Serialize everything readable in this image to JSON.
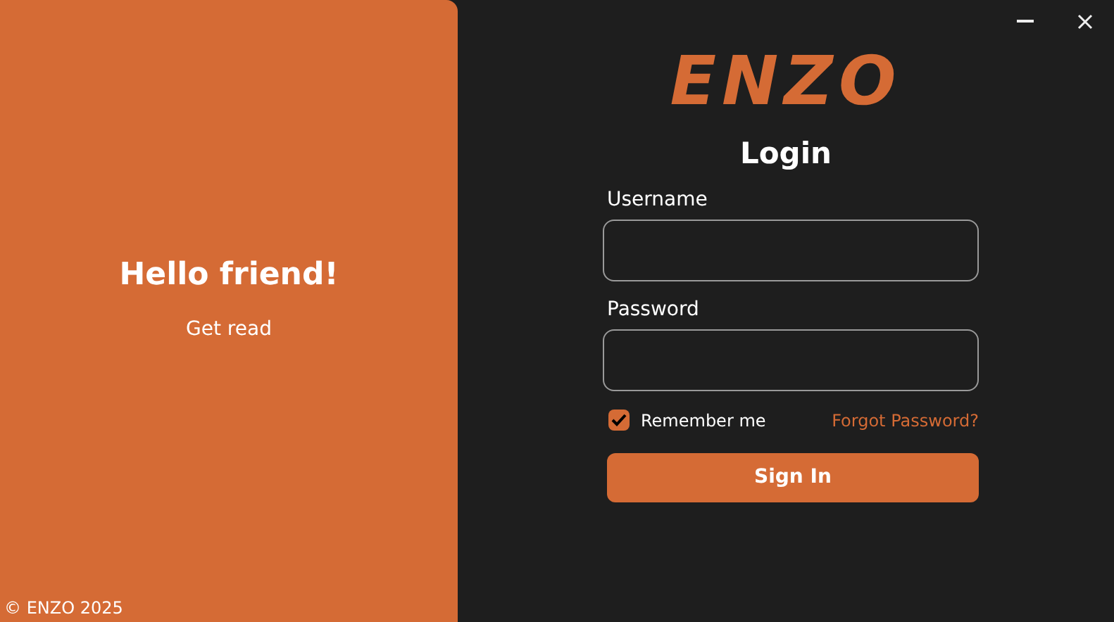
{
  "left_panel": {
    "heading": "Hello friend!",
    "subtitle": "Get read",
    "footer": "© ENZO 2025"
  },
  "logo": "ENZO",
  "title": "Login",
  "fields": [
    {
      "label": "Username"
    },
    {
      "label": "Password"
    }
  ],
  "remember": {
    "label": "Remember me",
    "checked": true
  },
  "forgot_link": "Forgot Password?",
  "sign_in_button": "Sign In"
}
